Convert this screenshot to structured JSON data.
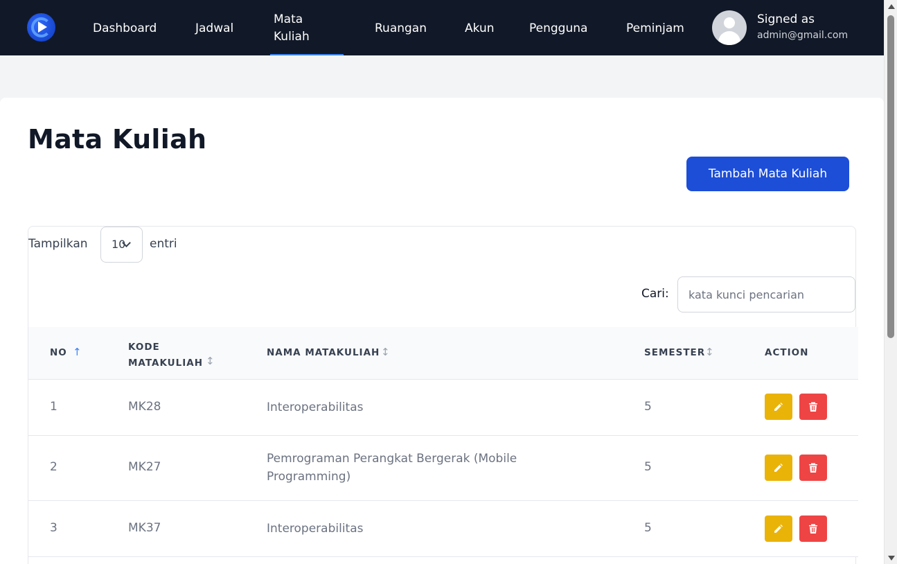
{
  "nav": {
    "items": [
      {
        "label": "Dashboard"
      },
      {
        "label": "Jadwal"
      },
      {
        "label": "Mata Kuliah"
      },
      {
        "label": "Ruangan"
      },
      {
        "label": "Akun"
      },
      {
        "label": "Pengguna"
      },
      {
        "label": "Peminjam"
      }
    ],
    "active_index": 2,
    "user": {
      "signed_label": "Signed as",
      "email": "admin@gmail.com"
    }
  },
  "page": {
    "title": "Mata Kuliah",
    "add_button": "Tambah Mata Kuliah"
  },
  "table_controls": {
    "length_label": "Tampilkan",
    "length_value": "10",
    "length_suffix": "entri",
    "search_label": "Cari:",
    "search_placeholder": "kata kunci pencarian",
    "search_value": ""
  },
  "table": {
    "headers": [
      "NO",
      "KODE MATAKULIAH",
      "NAMA MATAKULIAH",
      "SEMESTER",
      "ACTION"
    ],
    "sorted_column": "NO",
    "rows": [
      {
        "no": "1",
        "kode": "MK28",
        "nama": "Interoperabilitas",
        "semester": "5"
      },
      {
        "no": "2",
        "kode": "MK27",
        "nama": "Pemrograman Perangkat Bergerak (Mobile Programming)",
        "semester": "5"
      },
      {
        "no": "3",
        "kode": "MK37",
        "nama": "Interoperabilitas",
        "semester": "5"
      }
    ]
  },
  "icons": {
    "logo": "play-circle-icon",
    "edit": "pencil-icon",
    "delete": "trash-icon",
    "sort": "sort-arrows-icon",
    "sort_active": "arrow-up-icon",
    "select": "chevron-down-icon"
  },
  "colors": {
    "navbar": "#111827",
    "accent": "#1d4ed8",
    "active_underline": "#3b82f6",
    "edit_button": "#eab308",
    "delete_button": "#ef4444"
  }
}
